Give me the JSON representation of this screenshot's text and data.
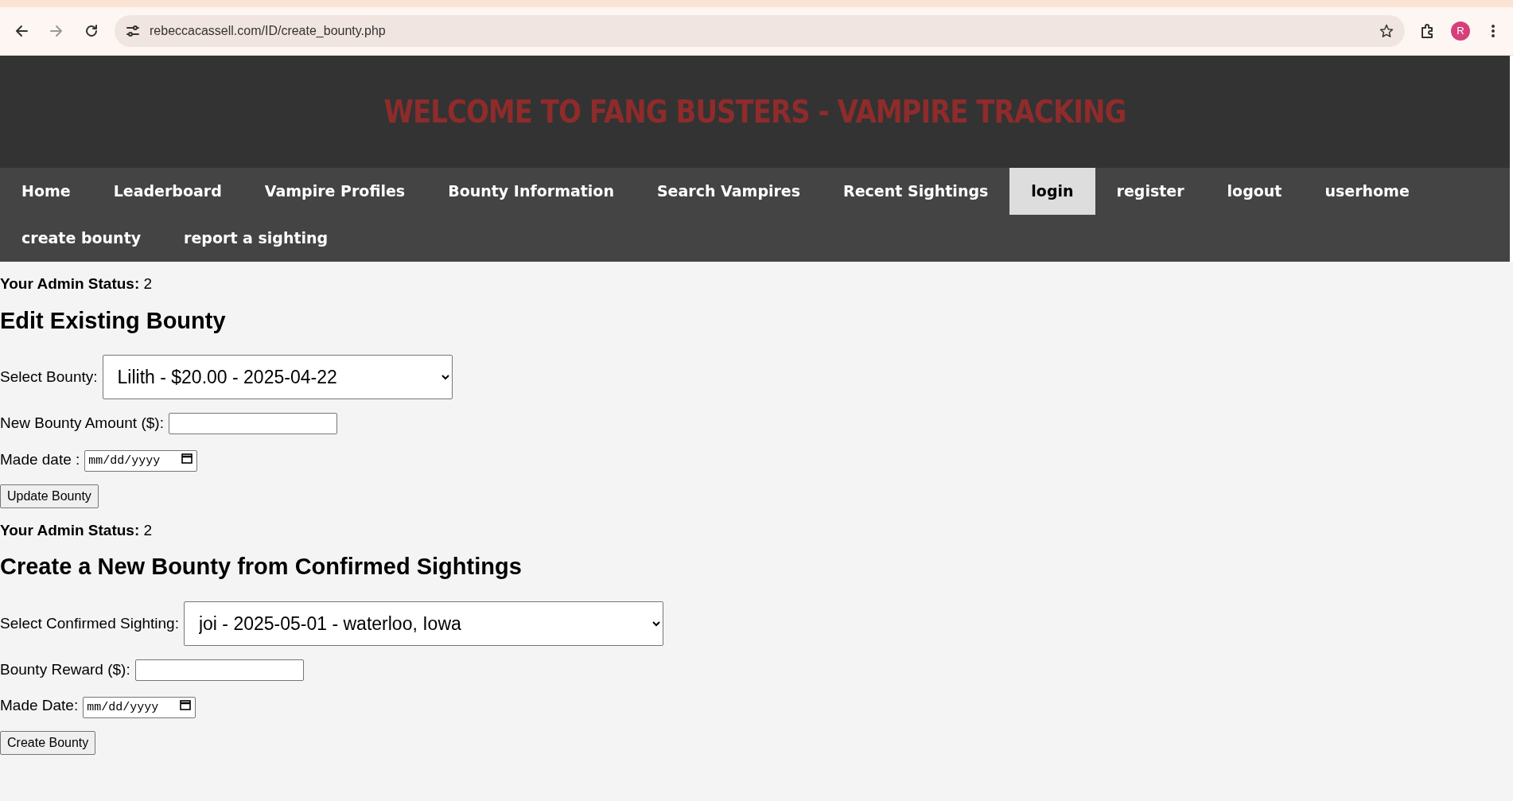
{
  "browser": {
    "url": "rebeccacassell.com/ID/create_bounty.php",
    "profile_initial": "R"
  },
  "header": {
    "title": "WELCOME TO FANG BUSTERS - VAMPIRE TRACKING"
  },
  "nav": [
    {
      "label": "Home",
      "selected": false
    },
    {
      "label": "Leaderboard",
      "selected": false
    },
    {
      "label": "Vampire Profiles",
      "selected": false
    },
    {
      "label": "Bounty Information",
      "selected": false
    },
    {
      "label": "Search Vampires",
      "selected": false
    },
    {
      "label": "Recent Sightings",
      "selected": false
    },
    {
      "label": "login",
      "selected": true
    },
    {
      "label": "register",
      "selected": false
    },
    {
      "label": "logout",
      "selected": false
    },
    {
      "label": "userhome",
      "selected": false
    },
    {
      "label": "create bounty",
      "selected": false
    },
    {
      "label": "report a sighting",
      "selected": false
    }
  ],
  "sections": [
    {
      "admin_label": "Your Admin Status:",
      "admin_value": "2",
      "heading": "Edit Existing Bounty",
      "fields": [
        {
          "kind": "select",
          "label": "Select Bounty:",
          "value": "Lilith - $20.00 - 2025-04-22"
        },
        {
          "kind": "text",
          "label": "New Bounty Amount ($):"
        },
        {
          "kind": "date",
          "label": "Made date :",
          "placeholder": "mm/dd/yyyy"
        }
      ],
      "button": "Update Bounty"
    },
    {
      "admin_label": "Your Admin Status:",
      "admin_value": "2",
      "heading": "Create a New Bounty from Confirmed Sightings",
      "fields": [
        {
          "kind": "select",
          "label": "Select Confirmed Sighting:",
          "value": "joi - 2025-05-01 - waterloo, Iowa"
        },
        {
          "kind": "text",
          "label": "Bounty Reward ($):"
        },
        {
          "kind": "date",
          "label": "Made Date:",
          "placeholder": "mm/dd/yyyy"
        }
      ],
      "button": "Create Bounty"
    }
  ]
}
